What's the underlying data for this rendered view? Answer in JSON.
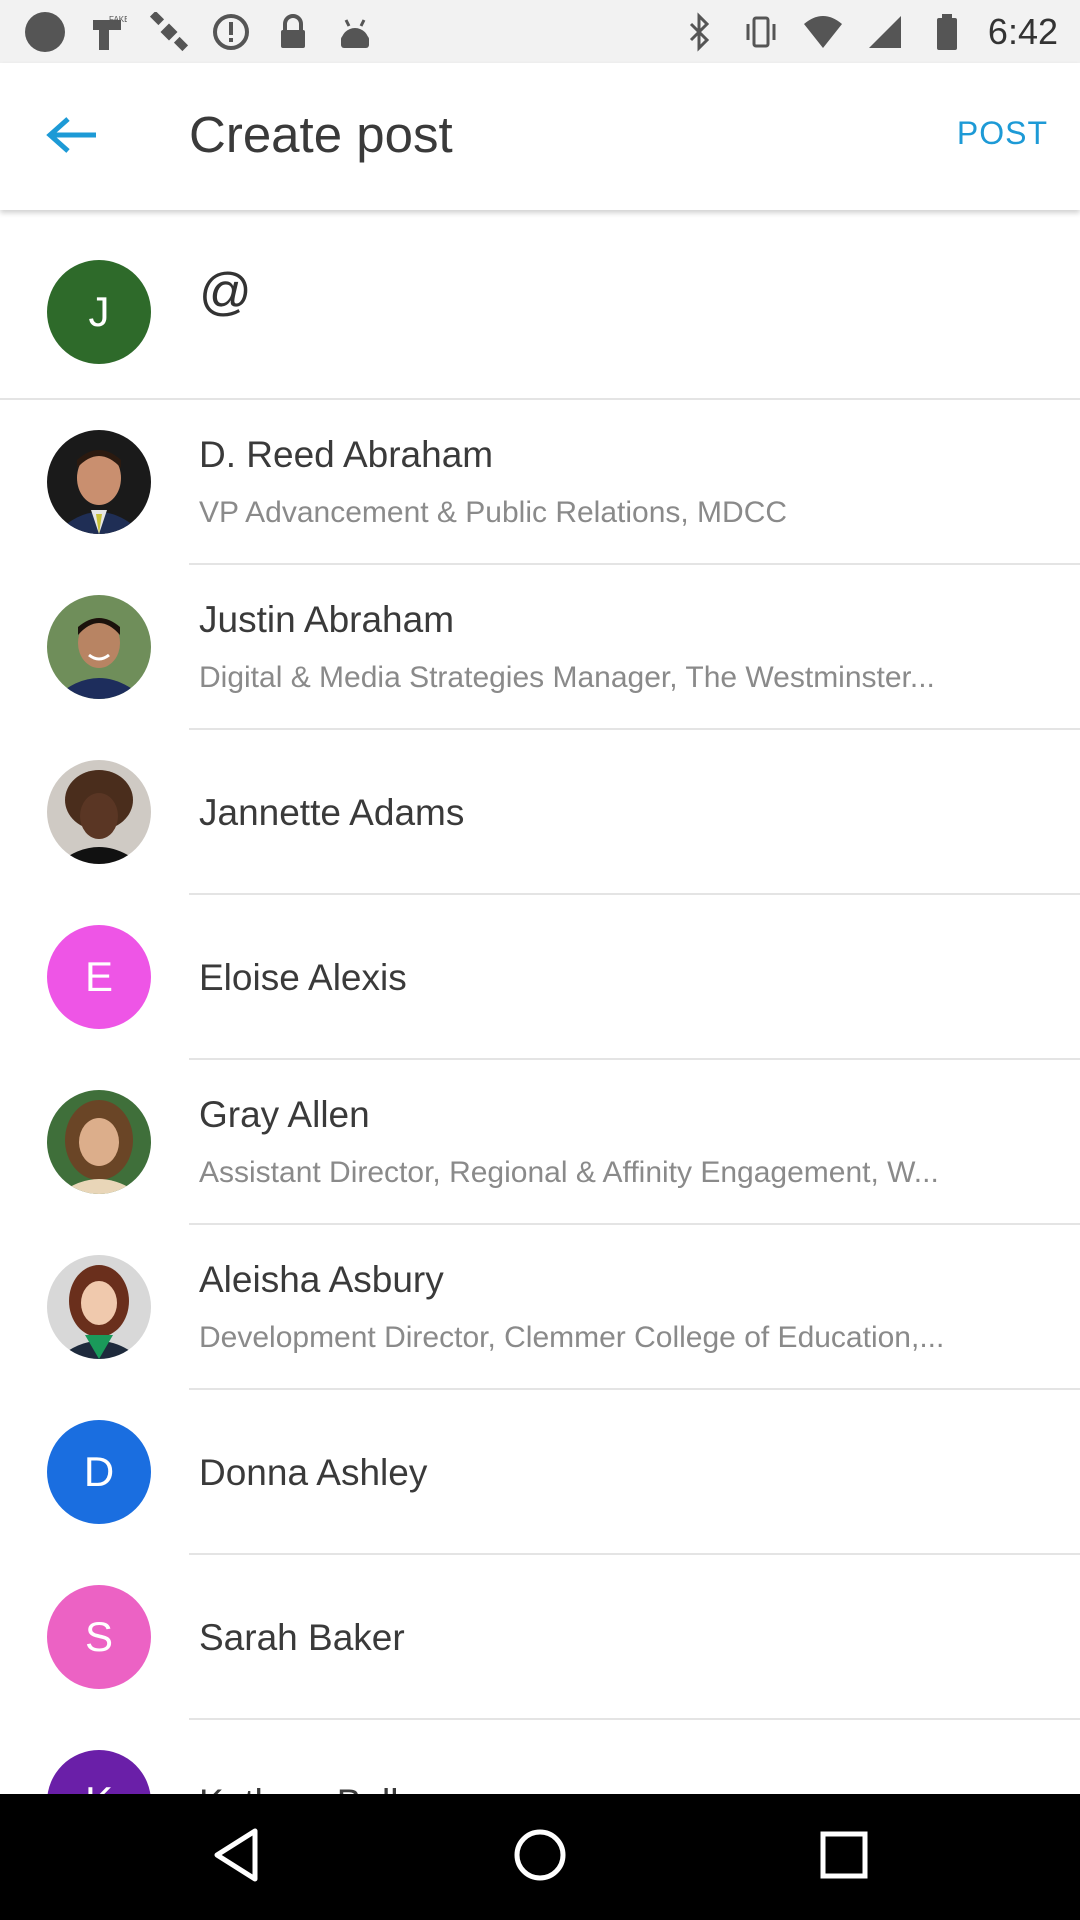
{
  "status_bar": {
    "time": "6:42",
    "icons": [
      "circle-icon",
      "fake-gps-icon",
      "satellite-icon",
      "alert-icon",
      "lock-icon",
      "android-icon",
      "bluetooth-icon",
      "vibrate-icon",
      "wifi-icon",
      "signal-icon",
      "battery-icon"
    ]
  },
  "app_bar": {
    "title": "Create post",
    "action": "POST",
    "back_icon": "arrow-left-icon",
    "accent": "#1d9ad6"
  },
  "compose": {
    "avatar_letter": "J",
    "avatar_color": "#2e6a2a",
    "value": "@"
  },
  "people": [
    {
      "name": "D. Reed Abraham",
      "subtitle": "VP Advancement & Public Relations, MDCC",
      "avatar": "photo"
    },
    {
      "name": "Justin Abraham",
      "subtitle": "Digital & Media Strategies Manager, The Westminster...",
      "avatar": "photo"
    },
    {
      "name": "Jannette Adams",
      "subtitle": "",
      "avatar": "photo"
    },
    {
      "name": "Eloise Alexis",
      "subtitle": "",
      "avatar_letter": "E",
      "avatar_color": "#ee55e6"
    },
    {
      "name": "Gray Allen",
      "subtitle": "Assistant Director, Regional & Affinity Engagement, W...",
      "avatar": "photo"
    },
    {
      "name": "Aleisha Asbury",
      "subtitle": "Development Director, Clemmer College of Education,...",
      "avatar": "photo"
    },
    {
      "name": "Donna Ashley",
      "subtitle": "",
      "avatar_letter": "D",
      "avatar_color": "#1a6ee0"
    },
    {
      "name": "Sarah Baker",
      "subtitle": "",
      "avatar_letter": "S",
      "avatar_color": "#ec62c4"
    },
    {
      "name": "Kathryn Bell",
      "subtitle": "",
      "avatar_letter": "K",
      "avatar_color": "#6a1fa8"
    }
  ],
  "nav_bar": {
    "back": "nav-back-icon",
    "home": "nav-home-icon",
    "recents": "nav-recents-icon"
  }
}
